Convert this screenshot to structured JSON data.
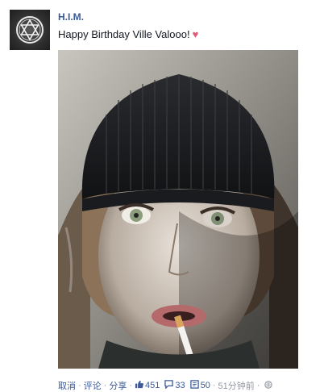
{
  "post": {
    "author": "H.I.M.",
    "message": "Happy Birthday Ville Valooo!",
    "photo_alt": "Portrait photo"
  },
  "actions": {
    "cancel": "取消",
    "comment": "评论",
    "share": "分享",
    "likes": "451",
    "comments_count": "33",
    "shares_count": "50",
    "timestamp": "51分钟前"
  },
  "colors": {
    "link": "#3b5998",
    "muted": "#9197a3",
    "heart": "#e05a7a"
  },
  "icons": [
    "hexagram-logo-icon",
    "heart-icon",
    "thumbs-up-icon",
    "comment-icon",
    "share-icon",
    "globe-icon"
  ]
}
